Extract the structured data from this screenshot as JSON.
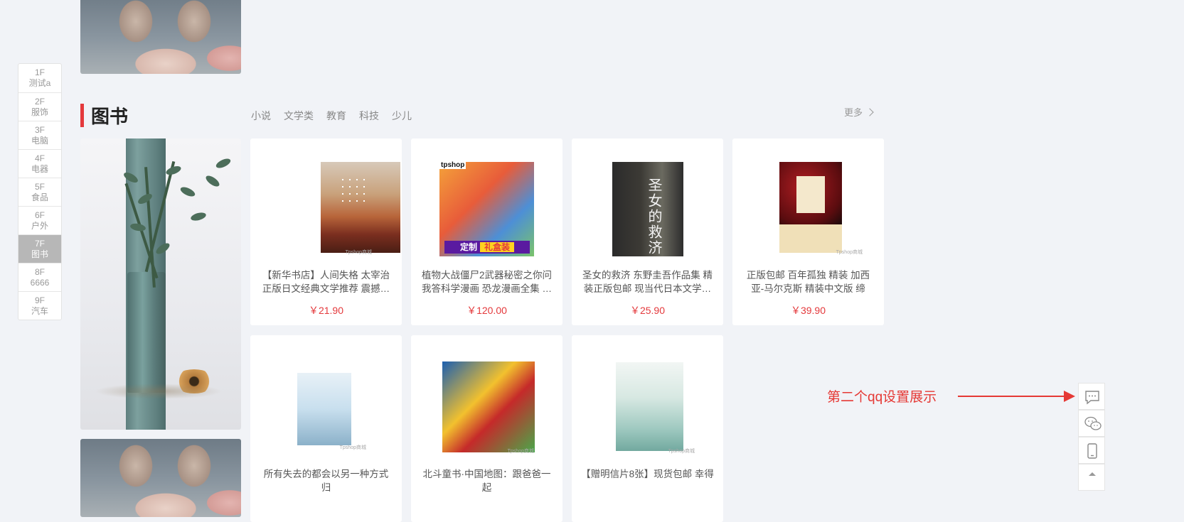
{
  "floors": [
    {
      "num": "1F",
      "label": "测试a"
    },
    {
      "num": "2F",
      "label": "服饰"
    },
    {
      "num": "3F",
      "label": "电脑"
    },
    {
      "num": "4F",
      "label": "电器"
    },
    {
      "num": "5F",
      "label": "食品"
    },
    {
      "num": "6F",
      "label": "户外"
    },
    {
      "num": "7F",
      "label": "图书",
      "active": true
    },
    {
      "num": "8F",
      "label": "6666"
    },
    {
      "num": "9F",
      "label": "汽车"
    }
  ],
  "section": {
    "title": "图书",
    "tabs": [
      "小说",
      "文学类",
      "教育",
      "科技",
      "少儿"
    ],
    "more_label": "更多"
  },
  "products": [
    {
      "name": "【新华书店】人间失格 太宰治正版日文经典文学推荐 震撼…",
      "price": "￥21.90"
    },
    {
      "name": "植物大战僵尸2武器秘密之你问我答科学漫画 恐龙漫画全集 …",
      "price": "￥120.00",
      "brand": "tpshop",
      "banner_a": "定制",
      "banner_b": "礼盒装"
    },
    {
      "name": "圣女的救济 东野圭吾作品集 精装正版包邮 现当代日本文学…",
      "price": "￥25.90",
      "cover_title": "圣女的救济"
    },
    {
      "name": "正版包邮 百年孤独 精装 加西亚-马尔克斯 精装中文版 缔造…",
      "price": "￥39.90"
    },
    {
      "name": "所有失去的都会以另一种方式归",
      "price": ""
    },
    {
      "name": "北斗童书·中国地图：跟爸爸一起",
      "price": ""
    },
    {
      "name": "【赠明信片8张】现货包邮 幸得",
      "price": ""
    }
  ],
  "watermark": "Tpshop商城",
  "annotation": "第二个qq设置展示",
  "toolbar": {
    "icons": [
      "message-icon",
      "wechat-icon",
      "mobile-icon",
      "top-icon"
    ]
  },
  "colors": {
    "accent": "#e4393c",
    "annotation": "#e53935"
  }
}
